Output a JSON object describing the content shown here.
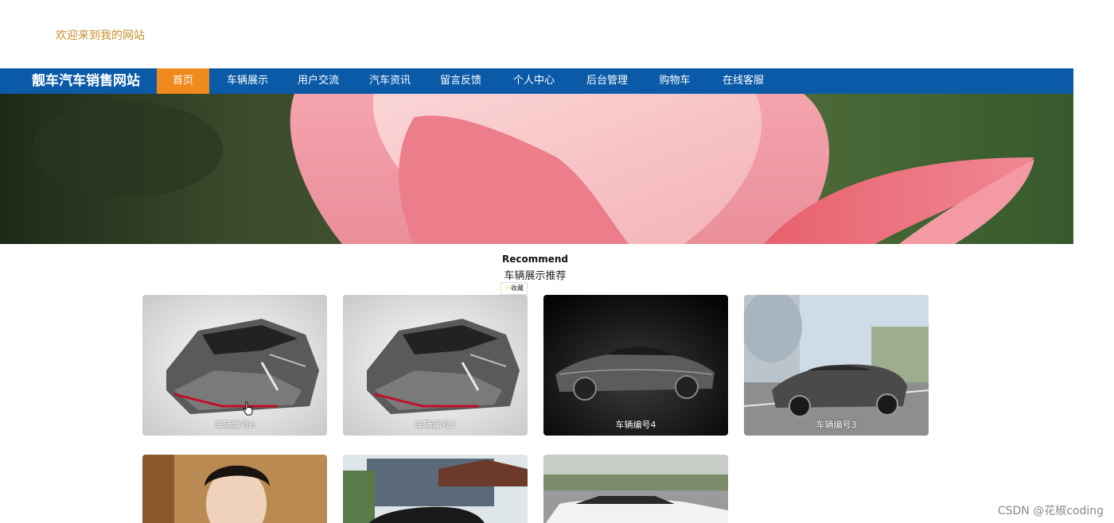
{
  "header": {
    "welcome_text": "欢迎来到我的网站"
  },
  "nav": {
    "brand": "靓车汽车销售网站",
    "items": [
      {
        "label": "首页",
        "active": true
      },
      {
        "label": "车辆展示"
      },
      {
        "label": "用户交流"
      },
      {
        "label": "汽车资讯"
      },
      {
        "label": "留言反馈"
      },
      {
        "label": "个人中心"
      },
      {
        "label": "后台管理"
      },
      {
        "label": "购物车"
      },
      {
        "label": "在线客服"
      }
    ],
    "accent_color": "#f08a1c",
    "bar_color": "#0a5aa8"
  },
  "banner": {
    "image": "pink-lotus-flower",
    "slides": 3,
    "active_slide": 1
  },
  "recommend": {
    "title_en": "Recommend",
    "title_cn": "车辆展示推荐",
    "favorite_label": "收藏"
  },
  "cards": [
    {
      "label": "车辆编号6",
      "image": "silver-supercar"
    },
    {
      "label": "车辆编号5",
      "image": "silver-supercar"
    },
    {
      "label": "车辆编号4",
      "image": "dark-concept-coupe"
    },
    {
      "label": "车辆编号3",
      "image": "grey-sedan-on-road"
    },
    {
      "label": "",
      "image": "woman-portrait"
    },
    {
      "label": "",
      "image": "black-sedan-building"
    },
    {
      "label": "",
      "image": "white-classic-car"
    }
  ],
  "watermark": "CSDN @花椒coding"
}
